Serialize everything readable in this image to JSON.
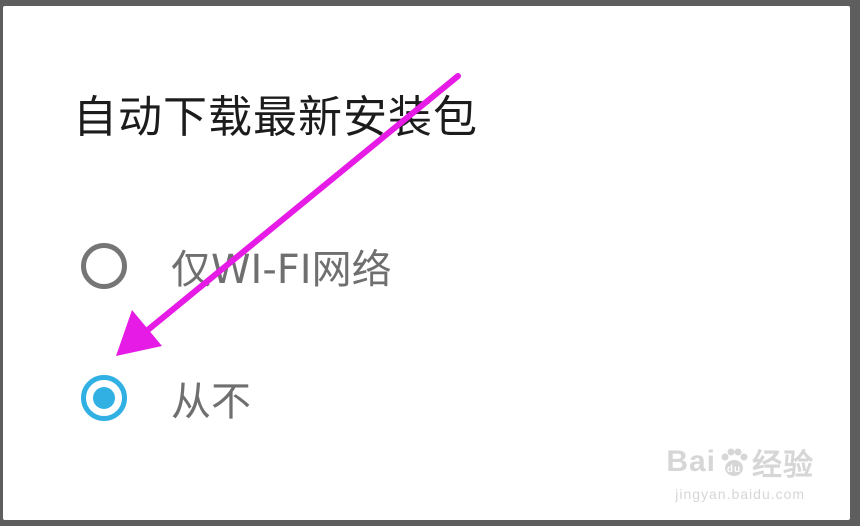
{
  "dialog": {
    "title": "自动下载最新安装包",
    "options": [
      {
        "label": "仅WI-FI网络",
        "selected": false
      },
      {
        "label": "从不",
        "selected": true
      }
    ]
  },
  "colors": {
    "accent": "#31b0e4",
    "radio_off": "#767676",
    "annotation_arrow": "#e61be6",
    "title_text": "#1c1c1c",
    "option_text": "#6f6f6f"
  },
  "watermark": {
    "brand_left": "Bai",
    "brand_right": "经验",
    "paw_text": "du",
    "url": "jingyan.baidu.com"
  }
}
